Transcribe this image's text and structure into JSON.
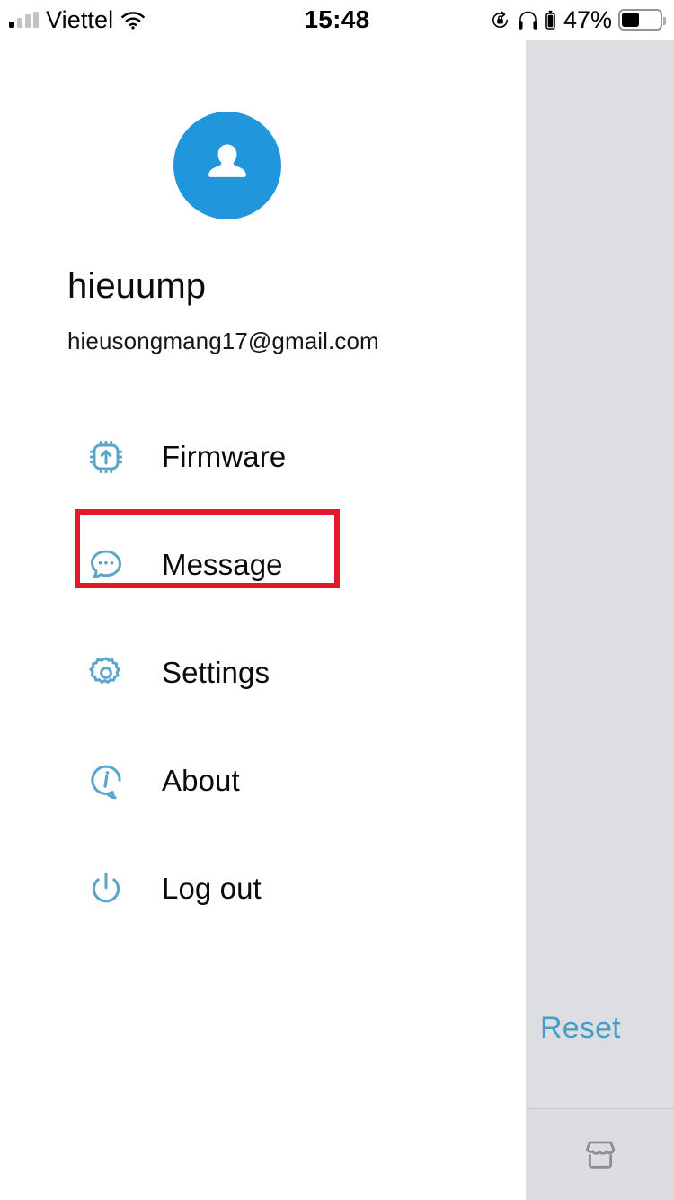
{
  "status_bar": {
    "carrier": "Viettel",
    "signal_icon": "cellular-signal-icon",
    "signal_bars_total": 4,
    "signal_bars_filled": 1,
    "wifi_icon": "wifi-icon",
    "time": "15:48",
    "rotation_lock_icon": "rotation-lock-icon",
    "headphones_icon": "headphones-icon",
    "headphones_battery_icon": "headphones-battery-icon",
    "battery_percent": "47%",
    "battery_icon": "battery-icon",
    "battery_level": 47
  },
  "drawer": {
    "avatar_icon": "person-avatar-icon",
    "avatar_color": "#2196dd",
    "username": "hieuump",
    "email": "hieusongmang17@gmail.com",
    "menu": [
      {
        "label": "Firmware",
        "icon": "chip-upload-icon"
      },
      {
        "label": "Message",
        "icon": "chat-bubble-icon"
      },
      {
        "label": "Settings",
        "icon": "gear-icon"
      },
      {
        "label": "About",
        "icon": "info-bubble-icon"
      },
      {
        "label": "Log out",
        "icon": "power-icon"
      }
    ],
    "icon_color": "#5ba4cb"
  },
  "highlight": {
    "target": "Message",
    "color": "#e2192c"
  },
  "background_panel": {
    "reset_label": "Reset",
    "reset_color": "#4a9cc4",
    "panel_color": "#dddee2",
    "tab_icon": "store-icon"
  }
}
